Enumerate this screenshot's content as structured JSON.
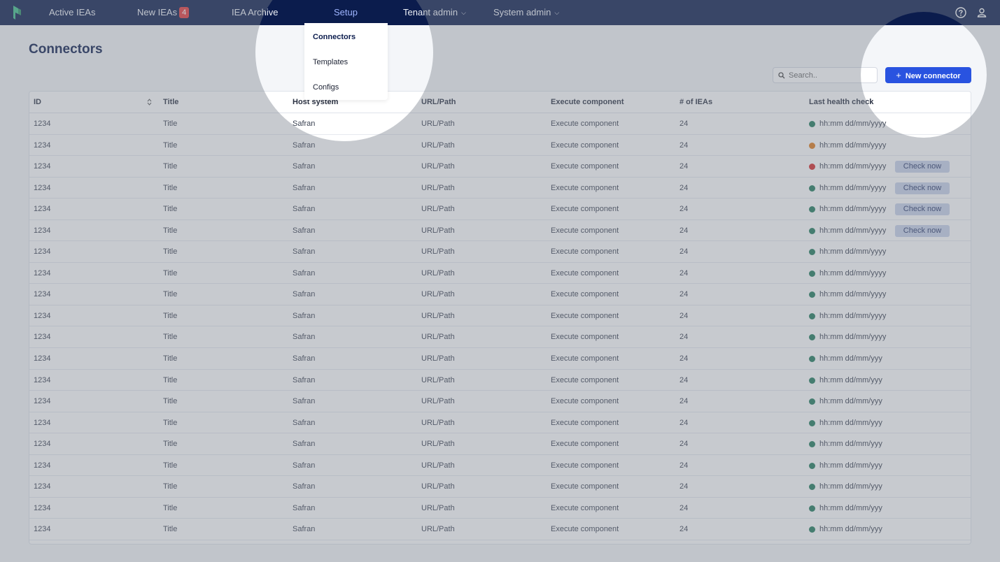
{
  "nav": {
    "items": [
      {
        "label": "Active IEAs"
      },
      {
        "label": "New IEAs",
        "badge": "4"
      },
      {
        "label": "IEA Archive"
      },
      {
        "label": "Setup"
      },
      {
        "label": "Tenant admin"
      },
      {
        "label": "System admin"
      }
    ],
    "icons": [
      "help-circle-icon",
      "user-icon"
    ],
    "colors": {
      "background": "#0b1c4d",
      "active": "#9fb5ff",
      "badge": "#e5393c"
    }
  },
  "dropdown": {
    "items": [
      "Connectors",
      "Templates",
      "Configs"
    ]
  },
  "page": {
    "title": "Connectors",
    "search_placeholder": "Search..",
    "new_button_label": "New connector"
  },
  "table": {
    "columns": [
      "ID",
      "Title",
      "Host system",
      "URL/Path",
      "Execute component",
      "# of IEAs",
      "Last health check"
    ],
    "check_label": "Check now",
    "status_colors": {
      "ok": "#1f7a5c",
      "warn": "#e07b1a",
      "error": "#d62a2a"
    },
    "rows": [
      {
        "id": "1234",
        "title": "Title",
        "host": "Safran",
        "url": "URL/Path",
        "exec": "Execute component",
        "ieas": "24",
        "health": "hh:mm dd/mm/yyyy",
        "status": "ok",
        "check": false
      },
      {
        "id": "1234",
        "title": "Title",
        "host": "Safran",
        "url": "URL/Path",
        "exec": "Execute component",
        "ieas": "24",
        "health": "hh:mm dd/mm/yyyy",
        "status": "warn",
        "check": false
      },
      {
        "id": "1234",
        "title": "Title",
        "host": "Safran",
        "url": "URL/Path",
        "exec": "Execute component",
        "ieas": "24",
        "health": "hh:mm dd/mm/yyyy",
        "status": "error",
        "check": true
      },
      {
        "id": "1234",
        "title": "Title",
        "host": "Safran",
        "url": "URL/Path",
        "exec": "Execute component",
        "ieas": "24",
        "health": "hh:mm dd/mm/yyyy",
        "status": "ok",
        "check": true
      },
      {
        "id": "1234",
        "title": "Title",
        "host": "Safran",
        "url": "URL/Path",
        "exec": "Execute component",
        "ieas": "24",
        "health": "hh:mm dd/mm/yyyy",
        "status": "ok",
        "check": true
      },
      {
        "id": "1234",
        "title": "Title",
        "host": "Safran",
        "url": "URL/Path",
        "exec": "Execute component",
        "ieas": "24",
        "health": "hh:mm dd/mm/yyyy",
        "status": "ok",
        "check": true
      },
      {
        "id": "1234",
        "title": "Title",
        "host": "Safran",
        "url": "URL/Path",
        "exec": "Execute component",
        "ieas": "24",
        "health": "hh:mm dd/mm/yyyy",
        "status": "ok",
        "check": false
      },
      {
        "id": "1234",
        "title": "Title",
        "host": "Safran",
        "url": "URL/Path",
        "exec": "Execute component",
        "ieas": "24",
        "health": "hh:mm dd/mm/yyyy",
        "status": "ok",
        "check": false
      },
      {
        "id": "1234",
        "title": "Title",
        "host": "Safran",
        "url": "URL/Path",
        "exec": "Execute component",
        "ieas": "24",
        "health": "hh:mm dd/mm/yyyy",
        "status": "ok",
        "check": false
      },
      {
        "id": "1234",
        "title": "Title",
        "host": "Safran",
        "url": "URL/Path",
        "exec": "Execute component",
        "ieas": "24",
        "health": "hh:mm dd/mm/yyyy",
        "status": "ok",
        "check": false
      },
      {
        "id": "1234",
        "title": "Title",
        "host": "Safran",
        "url": "URL/Path",
        "exec": "Execute component",
        "ieas": "24",
        "health": "hh:mm dd/mm/yyyy",
        "status": "ok",
        "check": false
      },
      {
        "id": "1234",
        "title": "Title",
        "host": "Safran",
        "url": "URL/Path",
        "exec": "Execute component",
        "ieas": "24",
        "health": "hh:mm dd/mm/yyy",
        "status": "ok",
        "check": false
      },
      {
        "id": "1234",
        "title": "Title",
        "host": "Safran",
        "url": "URL/Path",
        "exec": "Execute component",
        "ieas": "24",
        "health": "hh:mm dd/mm/yyy",
        "status": "ok",
        "check": false
      },
      {
        "id": "1234",
        "title": "Title",
        "host": "Safran",
        "url": "URL/Path",
        "exec": "Execute component",
        "ieas": "24",
        "health": "hh:mm dd/mm/yyy",
        "status": "ok",
        "check": false
      },
      {
        "id": "1234",
        "title": "Title",
        "host": "Safran",
        "url": "URL/Path",
        "exec": "Execute component",
        "ieas": "24",
        "health": "hh:mm dd/mm/yyy",
        "status": "ok",
        "check": false
      },
      {
        "id": "1234",
        "title": "Title",
        "host": "Safran",
        "url": "URL/Path",
        "exec": "Execute component",
        "ieas": "24",
        "health": "hh:mm dd/mm/yyy",
        "status": "ok",
        "check": false
      },
      {
        "id": "1234",
        "title": "Title",
        "host": "Safran",
        "url": "URL/Path",
        "exec": "Execute component",
        "ieas": "24",
        "health": "hh:mm dd/mm/yyy",
        "status": "ok",
        "check": false
      },
      {
        "id": "1234",
        "title": "Title",
        "host": "Safran",
        "url": "URL/Path",
        "exec": "Execute component",
        "ieas": "24",
        "health": "hh:mm dd/mm/yyy",
        "status": "ok",
        "check": false
      },
      {
        "id": "1234",
        "title": "Title",
        "host": "Safran",
        "url": "URL/Path",
        "exec": "Execute component",
        "ieas": "24",
        "health": "hh:mm dd/mm/yyy",
        "status": "ok",
        "check": false
      },
      {
        "id": "1234",
        "title": "Title",
        "host": "Safran",
        "url": "URL/Path",
        "exec": "Execute component",
        "ieas": "24",
        "health": "hh:mm dd/mm/yyy",
        "status": "ok",
        "check": false
      }
    ]
  }
}
